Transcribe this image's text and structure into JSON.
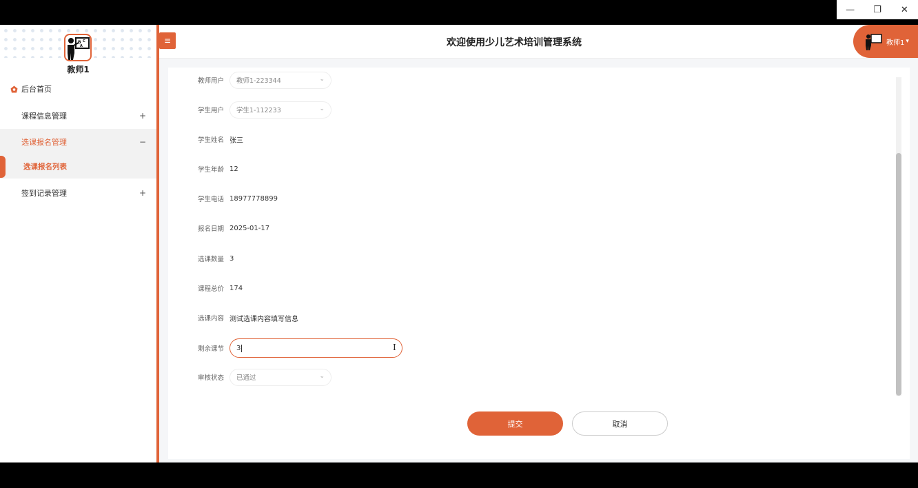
{
  "window": {
    "minimize": "—",
    "restore": "❐",
    "close": "✕"
  },
  "sidebar": {
    "profile_name": "教师1",
    "home_label": "后台首页",
    "menus": [
      {
        "label": "课程信息管理",
        "sign": "+"
      },
      {
        "label": "选课报名管理",
        "sign": "−"
      },
      {
        "label": "签到记录管理",
        "sign": "+"
      }
    ],
    "sub_active": "选课报名列表"
  },
  "header": {
    "toggle_icon": "≡",
    "title": "欢迎使用少儿艺术培训管理系统",
    "user_name": "教师1",
    "caret": "▾"
  },
  "form": {
    "teacher_user": {
      "label": "教师用户",
      "value": "教师1-223344"
    },
    "student_user": {
      "label": "学生用户",
      "value": "学生1-112233"
    },
    "student_name": {
      "label": "学生姓名",
      "value": "张三"
    },
    "student_age": {
      "label": "学生年龄",
      "value": "12"
    },
    "student_phone": {
      "label": "学生电话",
      "value": "18977778899"
    },
    "signup_date": {
      "label": "报名日期",
      "value": "2025-01-17"
    },
    "course_count": {
      "label": "选课数量",
      "value": "3"
    },
    "course_total": {
      "label": "课程总价",
      "value": "174"
    },
    "course_content": {
      "label": "选课内容",
      "value": "测试选课内容填写信息"
    },
    "remaining": {
      "label": "剩余课节",
      "value": "3"
    },
    "review_status": {
      "label": "审核状态",
      "value": "已通过"
    }
  },
  "buttons": {
    "submit": "提交",
    "cancel": "取消"
  },
  "colors": {
    "accent": "#e06338"
  }
}
